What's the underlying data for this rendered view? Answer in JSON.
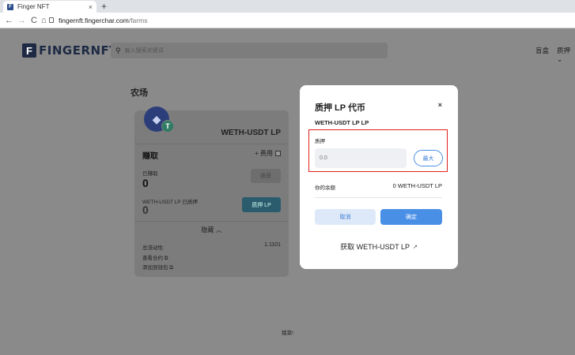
{
  "browser": {
    "tab_title": "Finger NFT",
    "tab_close": "×",
    "new_tab": "+",
    "url_host": "fingernft.fingerchar.com",
    "url_path": "/farms",
    "back": "←",
    "forward": "→",
    "reload": "C",
    "home": "⌂"
  },
  "header": {
    "logo_mark": "F",
    "logo_text": "FINGERNFT",
    "search_placeholder": "输入搜索关键词",
    "nav_blindbox": "盲盒",
    "nav_stake": "质押 ⌄"
  },
  "farm": {
    "title": "农场",
    "pair": "WETH-USDT LP",
    "eth_icon": "◆",
    "usdt_icon": "T",
    "earn_label": "赚取",
    "fee_label": "+ 费用",
    "earned_label": "已赚取",
    "earned_value": "0",
    "harvest_button": "收获",
    "staked_label": "WETH-USDT LP 已质押",
    "staked_value": "0",
    "stake_button": "质押 LP",
    "hide_label": "隐藏 ︿",
    "liquidity_label": "总流动性:",
    "liquidity_value": "1.1101",
    "link_contract": "查看合约 ⧉",
    "link_wallet": "添加到钱包 ⧉"
  },
  "footer": {
    "text": "猪菜!"
  },
  "modal": {
    "title": "质押 LP 代币",
    "close": "×",
    "pair": "WETH-USDT LP LP",
    "stake_label": "质押",
    "amount_placeholder": "0.0",
    "max_button": "最大",
    "balance_label": "你的余额",
    "balance_value": "0 WETH-USDT LP",
    "cancel_button": "取消",
    "confirm_button": "确定",
    "get_lp": "获取 WETH-USDT LP",
    "get_lp_icon": "↗"
  },
  "colors": {
    "highlight": "#e0201a",
    "primary": "#4a8fe6",
    "overlay": "#8a8a8a"
  }
}
